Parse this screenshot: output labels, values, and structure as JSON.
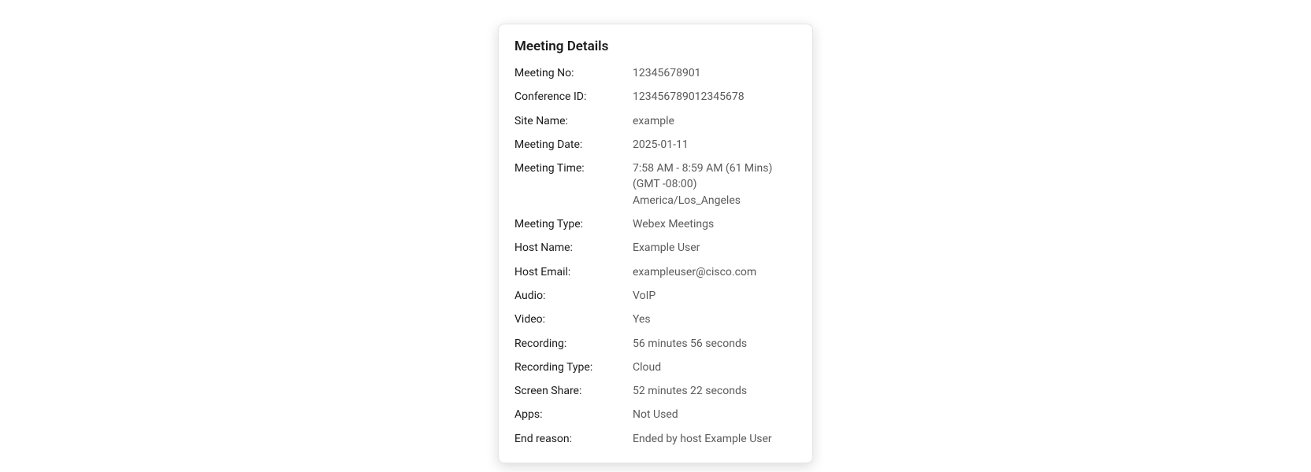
{
  "title": "Meeting Details",
  "rows": [
    {
      "label": "Meeting No:",
      "value": "12345678901"
    },
    {
      "label": "Conference ID:",
      "value": "123456789012345678"
    },
    {
      "label": "Site Name:",
      "value": "example"
    },
    {
      "label": "Meeting Date:",
      "value": "2025-01-11"
    },
    {
      "label": "Meeting Time:",
      "value": "7:58 AM - 8:59 AM (61 Mins) (GMT -08:00) America/Los_Angeles"
    },
    {
      "label": "Meeting Type:",
      "value": "Webex Meetings"
    },
    {
      "label": "Host Name:",
      "value": "Example User"
    },
    {
      "label": "Host Email:",
      "value": "exampleuser@cisco.com"
    },
    {
      "label": "Audio:",
      "value": "VoIP"
    },
    {
      "label": "Video:",
      "value": "Yes"
    },
    {
      "label": "Recording:",
      "value": "56 minutes 56 seconds"
    },
    {
      "label": "Recording Type:",
      "value": "Cloud"
    },
    {
      "label": "Screen Share:",
      "value": "52 minutes 22 seconds"
    },
    {
      "label": "Apps:",
      "value": "Not Used"
    },
    {
      "label": "End reason:",
      "value": "Ended by host Example User"
    }
  ]
}
